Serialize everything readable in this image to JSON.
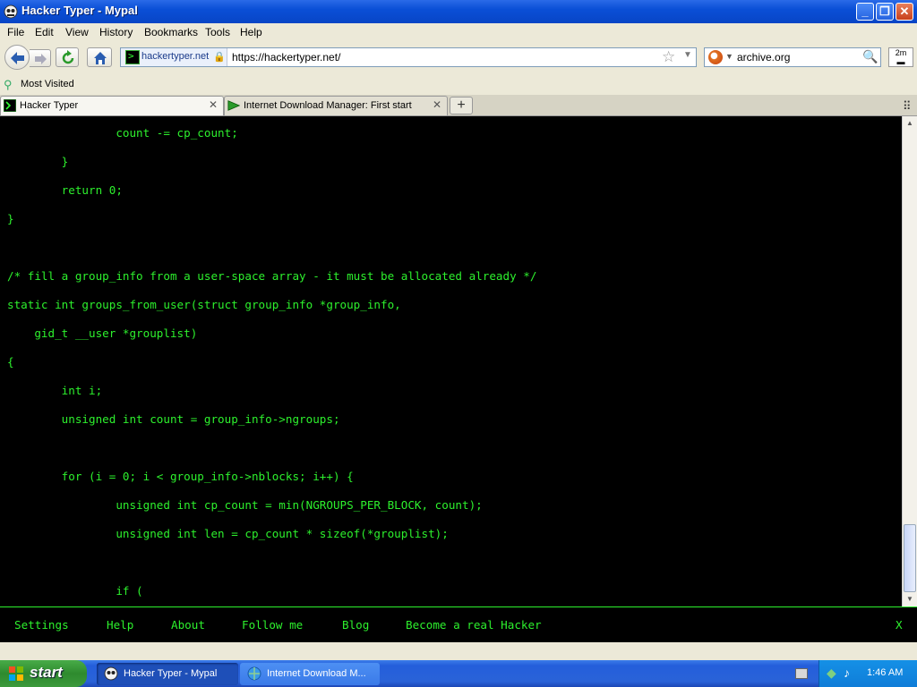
{
  "window": {
    "title": "Hacker Typer - Mypal",
    "buttons": [
      "minimize",
      "maximize",
      "close"
    ]
  },
  "menubar": {
    "items": [
      "File",
      "Edit",
      "View",
      "History",
      "Bookmarks",
      "Tools",
      "Help"
    ]
  },
  "navbar": {
    "identity_label": "hackertyper.net",
    "url": "https://hackertyper.net/",
    "search_text": "archive.org",
    "extension_label": "2m"
  },
  "bookmarks": {
    "items": [
      "Most Visited"
    ]
  },
  "tabs": [
    {
      "label": "Hacker Typer",
      "active": true
    },
    {
      "label": "Internet Download Manager: First start",
      "active": false
    }
  ],
  "code": {
    "lines": [
      "                count -= cp_count;",
      "        }",
      "        return 0;",
      "}",
      "",
      "/* fill a group_info from a user-space array - it must be allocated already */",
      "static int groups_from_user(struct group_info *group_info,",
      "    gid_t __user *grouplist)",
      "{",
      "        int i;",
      "        unsigned int count = group_info->ngroups;",
      "",
      "        for (i = 0; i < group_info->nblocks; i++) {",
      "                unsigned int cp_count = min(NGROUPS_PER_BLOCK, count);",
      "                unsigned int len = cp_count * sizeof(*grouplist);",
      "",
      "                if ("
    ],
    "text_color": "#2df02d"
  },
  "footer": {
    "links": [
      "Settings",
      "Help",
      "About",
      "Follow me",
      "Blog",
      "Become a real Hacker"
    ],
    "close_label": "X"
  },
  "taskbar": {
    "start_label": "start",
    "tasks": [
      {
        "label": "Hacker Typer - Mypal",
        "active": true
      },
      {
        "label": "Internet Download M...",
        "active": false
      }
    ],
    "clock": "1:46 AM"
  },
  "colors": {
    "accent_green": "#2df02d",
    "titlebar_blue": "#0a4fd6",
    "taskbar_blue": "#245edb",
    "start_green": "#3c9a3c"
  }
}
